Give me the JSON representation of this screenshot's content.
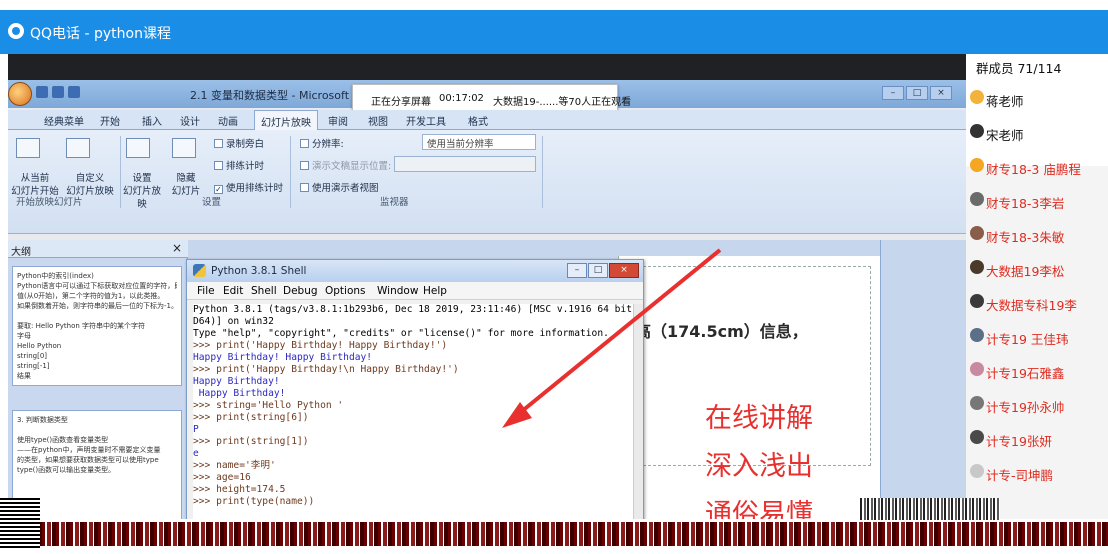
{
  "window": {
    "title": "QQ电话 - python课程"
  },
  "share_status": {
    "state": "正在分享屏幕",
    "elapsed": "00:17:02",
    "viewers": "大数据19-......等70人正在观看"
  },
  "ppt": {
    "doc_title": "2.1 变量和数据类型 - Microsoft Pow",
    "win_buttons": [
      "–",
      "□",
      "×"
    ],
    "tabs": [
      "经典菜单",
      "开始",
      "插入",
      "设计",
      "动画",
      "幻灯片放映",
      "审阅",
      "视图",
      "开发工具",
      "格式"
    ],
    "ribbon": {
      "from_start": "从当前\n幻灯片开始",
      "custom_show": "自定义\n幻灯片放映",
      "group_start": "开始放映幻灯片",
      "setup": "设置\n幻灯片放映",
      "hide": "隐藏\n幻灯片",
      "record_narration": "录制旁白",
      "rehearse_timings": "排练计时",
      "use_timings": "使用排练计时",
      "group_setup": "设置",
      "resolution_label": "分辨率:",
      "resolution_value": "使用当前分辨率",
      "show_on": "演示文稿显示位置:",
      "presenter_view": "使用演示者视图",
      "group_monitors": "监视器"
    },
    "slide_pane_tab": "大纲",
    "slide_pane_close": "×",
    "thumb1_lines": [
      "Python中的索引(index)",
      "Python语言中可以通过下标获取对应位置的字符，即一个",
      "值(从0开始)，第二个字符的值为1，以此类推。",
      "如果倒数着开始，则字符串的最后一位的下标为-1。",
      "",
      "要取: Hello Python 字符串中的某个字符",
      "字母",
      "Hello Python",
      "string[0]",
      "string[-1]",
      "结果"
    ],
    "thumb2_lines": [
      "3. 判断数据类型",
      "",
      "使用type()函数查看变量类型",
      "——在python中，声明变量时不需要定义变量",
      "的类型，如果想要获取数据类型可以使用type",
      "type()函数可以输出变量类型。"
    ],
    "slide_height_text": "身高（174.5cm）信息，",
    "slide_overlay": [
      "在线讲解",
      "深入浅出",
      "通俗易懂"
    ]
  },
  "python_shell": {
    "title": "Python 3.8.1 Shell",
    "win_buttons": [
      "–",
      "□",
      "×"
    ],
    "menu": [
      "File",
      "Edit",
      "Shell",
      "Debug",
      "Options",
      "Window",
      "Help"
    ],
    "lines": [
      {
        "kind": "out",
        "text": "Python 3.8.1 (tags/v3.8.1:1b293b6, Dec 18 2019, 23:11:46) [MSC v.1916 64 bit (AM"
      },
      {
        "kind": "out",
        "text": "D64)] on win32"
      },
      {
        "kind": "out",
        "text": "Type \"help\", \"copyright\", \"credits\" or \"license()\" for more information."
      },
      {
        "kind": "prompt",
        "text": ">>> print('Happy Birthday! Happy Birthday!')"
      },
      {
        "kind": "stdout",
        "text": "Happy Birthday! Happy Birthday!"
      },
      {
        "kind": "prompt",
        "text": ">>> print('Happy Birthday!\\n Happy Birthday!')"
      },
      {
        "kind": "stdout",
        "text": "Happy Birthday!"
      },
      {
        "kind": "stdout",
        "text": " Happy Birthday!"
      },
      {
        "kind": "prompt",
        "text": ">>> string='Hello Python '"
      },
      {
        "kind": "prompt",
        "text": ">>> print(string[6])"
      },
      {
        "kind": "stdout",
        "text": "P"
      },
      {
        "kind": "prompt",
        "text": ">>> print(string[1])"
      },
      {
        "kind": "stdout",
        "text": "e"
      },
      {
        "kind": "prompt",
        "text": ">>> name='李明'"
      },
      {
        "kind": "prompt",
        "text": ">>> age=16"
      },
      {
        "kind": "prompt",
        "text": ">>> height=174.5"
      },
      {
        "kind": "prompt",
        "text": ">>> print(type(name))"
      }
    ]
  },
  "members": {
    "header": "群成员 71/114",
    "list": [
      {
        "name": "蒋老师",
        "color": "#111111"
      },
      {
        "name": "宋老师",
        "color": "#111111"
      },
      {
        "name": "财专18-3 庙鹏程",
        "color": "#e02b1f"
      },
      {
        "name": "财专18-3李岩",
        "color": "#e02b1f"
      },
      {
        "name": "财专18-3朱敏",
        "color": "#e02b1f"
      },
      {
        "name": "大数据19李松",
        "color": "#e02b1f"
      },
      {
        "name": "大数据专科19李",
        "color": "#e02b1f"
      },
      {
        "name": "计专19 王佳玮",
        "color": "#e02b1f"
      },
      {
        "name": "计专19石雅鑫",
        "color": "#e02b1f"
      },
      {
        "name": "计专19孙永帅",
        "color": "#e02b1f"
      },
      {
        "name": "计专19张妍",
        "color": "#e02b1f"
      },
      {
        "name": "计专-司坤鹏",
        "color": "#e02b1f"
      }
    ]
  },
  "colors": {
    "qq_blue": "#1a8de6",
    "annotation_red": "#e8312f"
  }
}
